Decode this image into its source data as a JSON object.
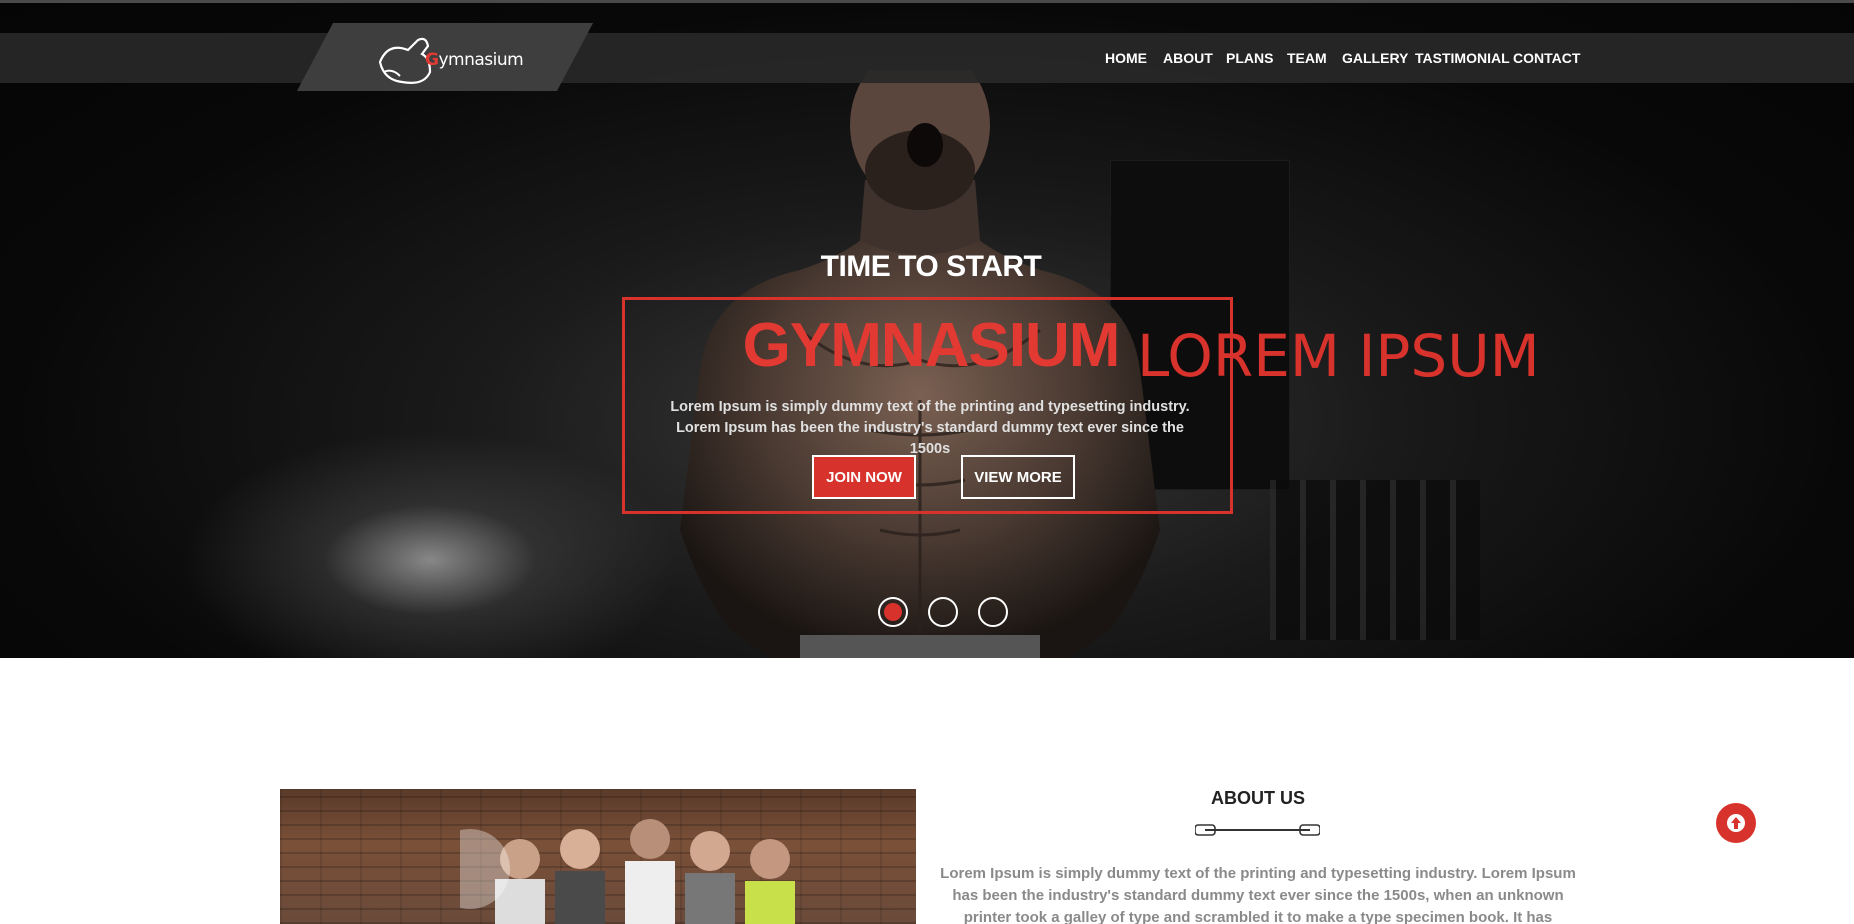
{
  "brand": {
    "logo_letter": "G",
    "logo_rest": "ymnasium"
  },
  "nav": {
    "items": [
      {
        "label": "HOME"
      },
      {
        "label": "ABOUT"
      },
      {
        "label": "PLANS"
      },
      {
        "label": "TEAM"
      },
      {
        "label": "GALLERY"
      },
      {
        "label": "TASTIMONIAL"
      },
      {
        "label": "CONTACT"
      }
    ]
  },
  "hero": {
    "kicker": "TIME TO START",
    "title": "GYMNASIUM",
    "side_text": "LOREM IPSUM",
    "description": "Lorem Ipsum is simply dummy text of the printing and typesetting industry. Lorem Ipsum has been the industry's standard dummy text ever since the 1500s",
    "join_label": "JOIN NOW",
    "view_label": "VIEW MORE",
    "slide_count": 3,
    "active_slide": 1
  },
  "about": {
    "title": "ABOUT US",
    "text": "Lorem Ipsum is simply dummy text of the printing and typesetting industry. Lorem Ipsum has been the industry's standard dummy text ever since the 1500s, when an unknown printer took a galley of type and scrambled it to make a type specimen book. It has survived not only five"
  },
  "colors": {
    "accent": "#d8322c",
    "nav_bg": "#282828",
    "hero_bg": "#080808"
  },
  "icons": {
    "scroll_top": "arrow-up-circle-icon",
    "divider": "barbell-icon",
    "logo": "flexed-arm-icon"
  }
}
